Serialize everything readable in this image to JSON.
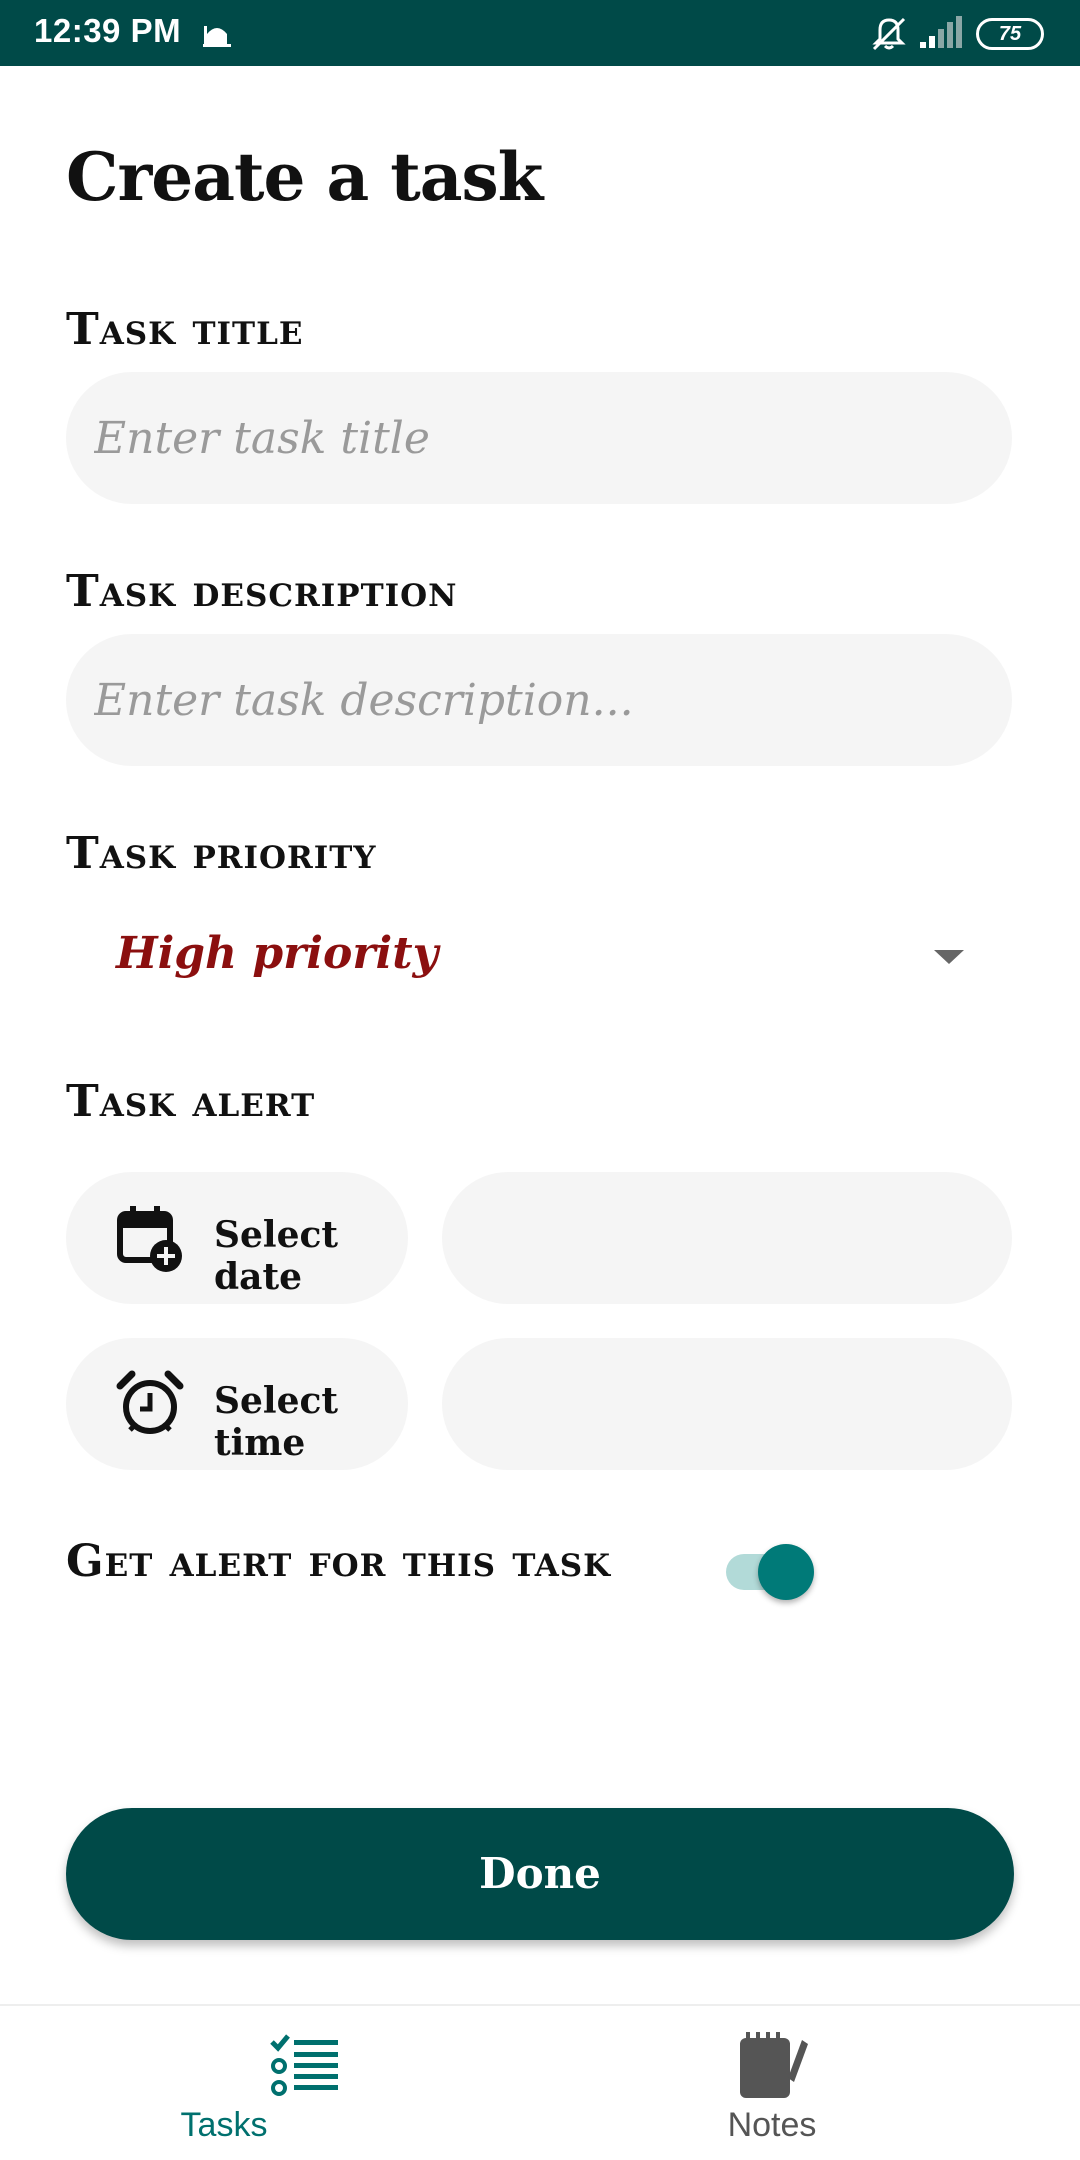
{
  "status_bar": {
    "time": "12:39 PM",
    "battery": "75",
    "notification_icon": "mosque-icon",
    "silent_icon": "bell-off-icon",
    "signal_icon": "signal-icon"
  },
  "page": {
    "title": "Create a task"
  },
  "form": {
    "title_label": "Task title",
    "title_placeholder": "Enter task title",
    "title_value": "",
    "description_label": "Task description",
    "description_placeholder": "Enter task description...",
    "description_value": "",
    "priority_label": "Task priority",
    "priority_value": "High priority",
    "priority_color": "#8b0f0f",
    "alert_label": "Task alert",
    "select_date_label": "Select date",
    "select_time_label": "Select time",
    "date_value": "",
    "time_value": "",
    "get_alert_label": "Get alert for this task",
    "get_alert_enabled": true
  },
  "actions": {
    "done_label": "Done"
  },
  "bottom_nav": {
    "items": [
      {
        "label": "Tasks",
        "icon": "checklist-icon",
        "active": true
      },
      {
        "label": "Notes",
        "icon": "notepad-icon",
        "active": false
      }
    ]
  },
  "colors": {
    "primary": "#004a48",
    "accent": "#007a78",
    "field_bg": "#f5f5f5"
  }
}
